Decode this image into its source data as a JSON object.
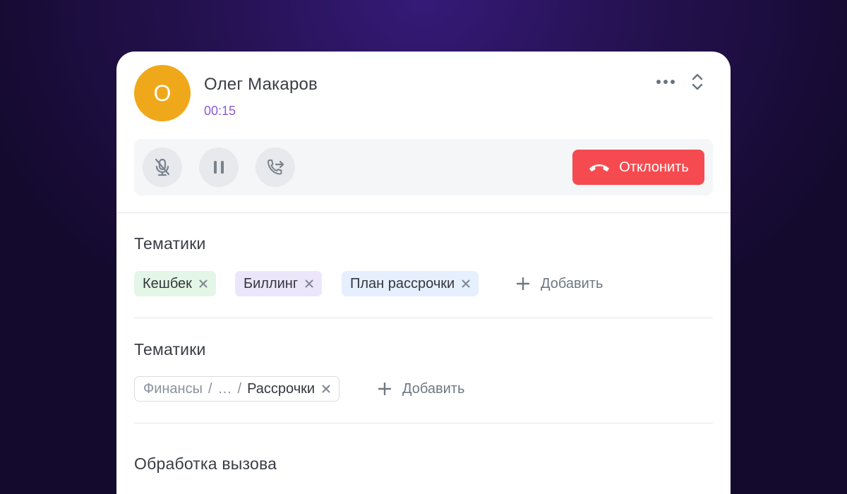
{
  "caller": {
    "initial": "О",
    "name": "Олег Макаров",
    "timer": "00:15"
  },
  "header": {
    "more_icon": "more-horizontal-icon",
    "expand_icon": "chevron-up-down-icon"
  },
  "controls": {
    "mute_icon": "mic-off-icon",
    "pause_icon": "pause-icon",
    "transfer_icon": "phone-forward-icon",
    "decline_label": "Отклонить",
    "decline_icon": "phone-hangup-icon"
  },
  "sections": [
    {
      "title": "Тематики",
      "tags": [
        {
          "label": "Кешбек",
          "color": "#e3f6e7"
        },
        {
          "label": "Биллинг",
          "color": "#ece6fb"
        },
        {
          "label": "План рассрочки",
          "color": "#e6effd"
        }
      ],
      "add_label": "Добавить"
    },
    {
      "title": "Тематики",
      "path_tag": {
        "root": "Финансы",
        "ellipsis": "…",
        "leaf": "Рассрочки",
        "separator": "/"
      },
      "add_label": "Добавить"
    },
    {
      "title": "Обработка вызова"
    }
  ],
  "colors": {
    "accent_purple": "#8b5cd6",
    "avatar": "#f0a81b",
    "decline": "#f54b50"
  }
}
